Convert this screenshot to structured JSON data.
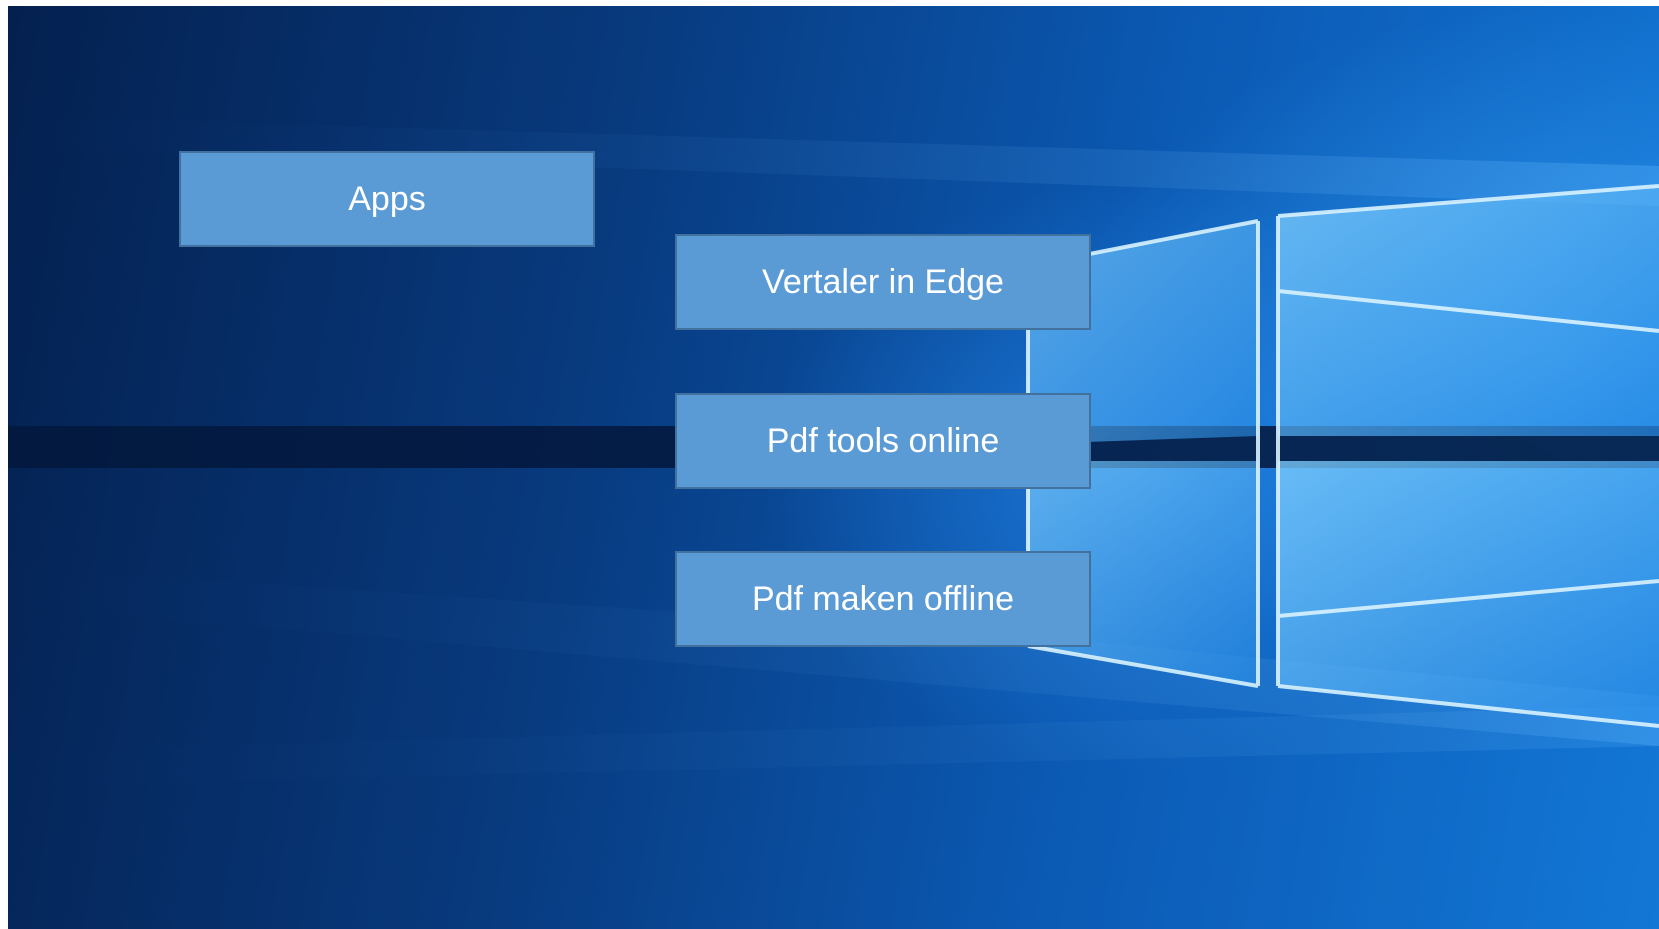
{
  "colors": {
    "tile_fill": "#5b9bd5",
    "tile_border": "#41719c",
    "tile_text": "#ffffff",
    "background_dark": "#04204f",
    "background_light": "#1377d6"
  },
  "background": {
    "icon": "windows-logo-wallpaper"
  },
  "tiles": {
    "apps": "Apps",
    "vertaler": "Vertaler in Edge",
    "pdf_tools": "Pdf tools online",
    "pdf_maken": "Pdf maken offline"
  }
}
